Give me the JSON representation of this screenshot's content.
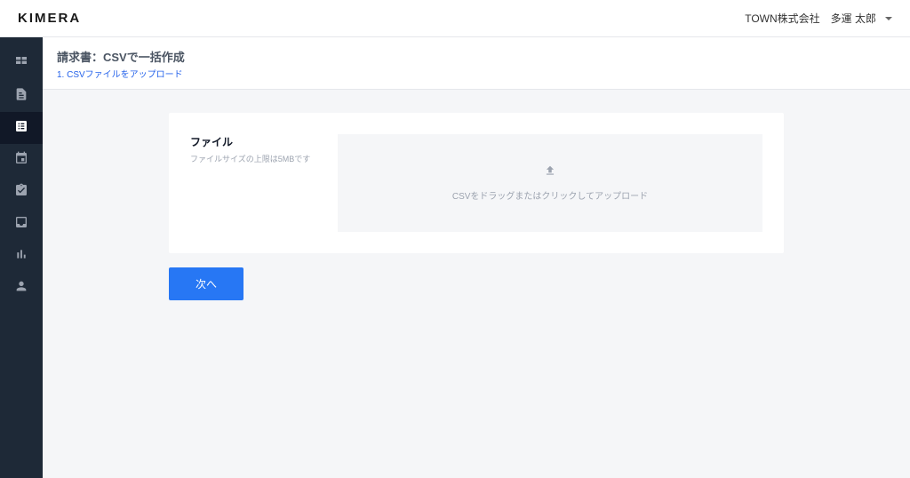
{
  "header": {
    "logo": "KIMERA",
    "company": "TOWN株式会社",
    "user": "多運 太郎"
  },
  "page": {
    "title": "請求書：CSVで一括作成",
    "subtitle": "1. CSVファイルをアップロード"
  },
  "upload": {
    "sectionLabel": "ファイル",
    "sizeHint": "ファイルサイズの上限は5MBです",
    "dropzoneText": "CSVをドラッグまたはクリックしてアップロード"
  },
  "buttons": {
    "next": "次へ"
  }
}
